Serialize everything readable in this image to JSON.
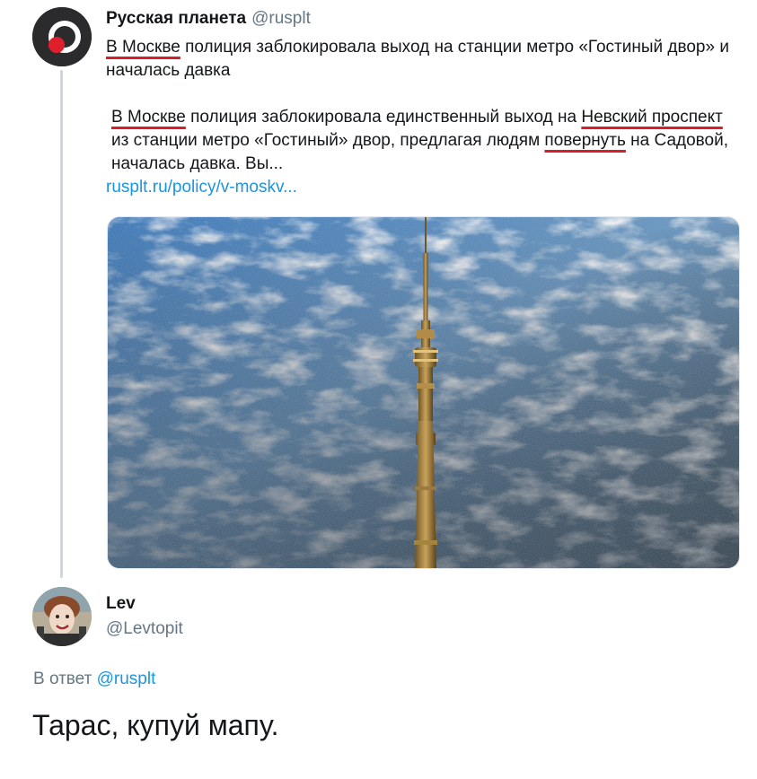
{
  "tweet": {
    "display_name": "Русская планета",
    "handle": "@rusplt",
    "headline_part1": "В Москве",
    "headline_part2": " полиция заблокировала выход на станции метро «Гостиный двор» и началась давка",
    "body_part1": "В Москве",
    "body_part2": " полиция заблокировала единственный выход на ",
    "body_part3": "Невский проспект",
    "body_part4": " из станции метро «Гостиный» двор, предлагая людям ",
    "body_part5": "повернуть",
    "body_part6": " на Садовой, началась давка. Вы...",
    "link_text": "rusplt.ru/policy/v-moskv..."
  },
  "reply": {
    "display_name": "Lev",
    "handle": "@Levtopit",
    "reply_to_label": "В ответ ",
    "reply_to_handle": "@rusplt",
    "text": "Тарас, купуй мапу."
  },
  "colors": {
    "link": "#1b95e0",
    "underline_red": "#d81e2a",
    "secondary_text": "#657786"
  }
}
